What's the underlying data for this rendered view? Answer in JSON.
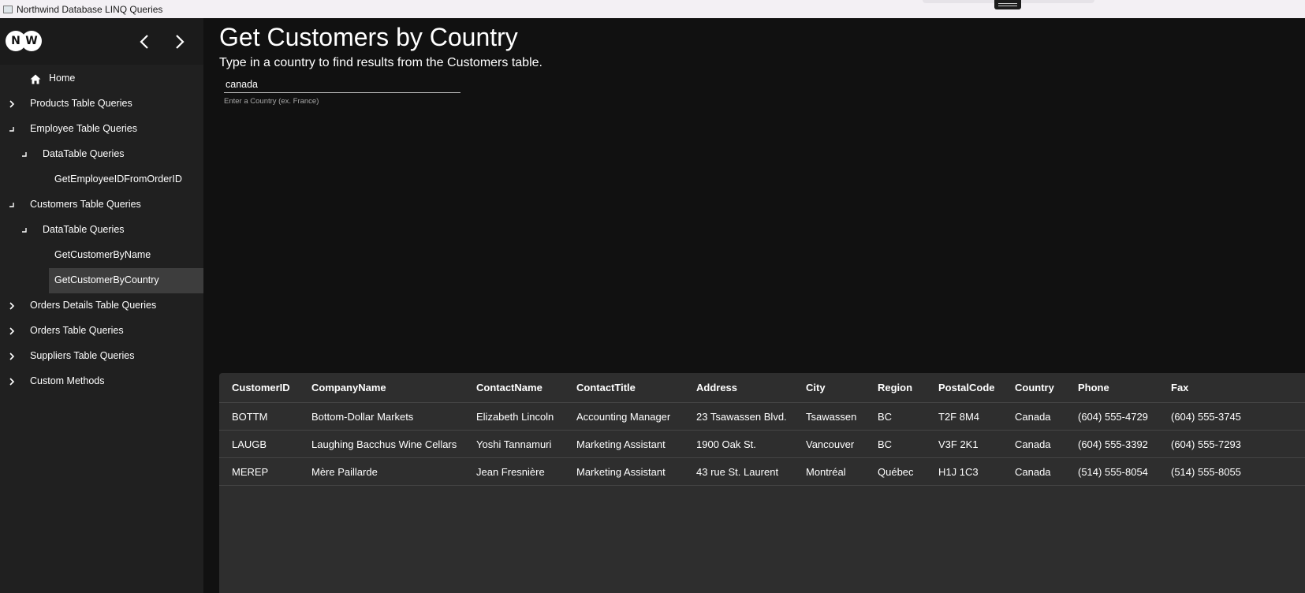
{
  "window": {
    "title": "Northwind Database LINQ Queries"
  },
  "logo": {
    "left": "N",
    "right": "W"
  },
  "nav": [
    {
      "label": "Home",
      "glyph": "home-icon",
      "level": 0,
      "selected": false
    },
    {
      "label": "Products Table Queries",
      "glyph": "chevron-right-icon",
      "level": 0,
      "selected": false
    },
    {
      "label": "Employee Table Queries",
      "glyph": "expanded-icon",
      "level": 0,
      "selected": false
    },
    {
      "label": "DataTable Queries",
      "glyph": "expanded-icon",
      "level": 1,
      "selected": false
    },
    {
      "label": "GetEmployeeIDFromOrderID",
      "glyph": "",
      "level": 2,
      "selected": false
    },
    {
      "label": "Customers Table Queries",
      "glyph": "expanded-icon",
      "level": 0,
      "selected": false
    },
    {
      "label": "DataTable Queries",
      "glyph": "expanded-icon",
      "level": 1,
      "selected": false
    },
    {
      "label": "GetCustomerByName",
      "glyph": "",
      "level": 2,
      "selected": false
    },
    {
      "label": "GetCustomerByCountry",
      "glyph": "",
      "level": 2,
      "selected": true
    },
    {
      "label": "Orders Details Table Queries",
      "glyph": "chevron-right-icon",
      "level": 0,
      "selected": false
    },
    {
      "label": "Orders Table Queries",
      "glyph": "chevron-right-icon",
      "level": 0,
      "selected": false
    },
    {
      "label": "Suppliers Table Queries",
      "glyph": "chevron-right-icon",
      "level": 0,
      "selected": false
    },
    {
      "label": "Custom Methods",
      "glyph": "chevron-right-icon",
      "level": 0,
      "selected": false
    }
  ],
  "main": {
    "title": "Get Customers by Country",
    "subtitle": "Type in a country to find results from the Customers table.",
    "search": {
      "value": "canada",
      "help": "Enter a Country (ex. France)"
    }
  },
  "table": {
    "columns": [
      "CustomerID",
      "CompanyName",
      "ContactName",
      "ContactTitle",
      "Address",
      "City",
      "Region",
      "PostalCode",
      "Country",
      "Phone",
      "Fax"
    ],
    "rows": [
      [
        "BOTTM",
        "Bottom-Dollar Markets",
        "Elizabeth Lincoln",
        "Accounting Manager",
        "23 Tsawassen Blvd.",
        "Tsawassen",
        "BC",
        "T2F 8M4",
        "Canada",
        "(604) 555-4729",
        "(604) 555-3745"
      ],
      [
        "LAUGB",
        "Laughing Bacchus Wine Cellars",
        "Yoshi Tannamuri",
        "Marketing Assistant",
        "1900 Oak St.",
        "Vancouver",
        "BC",
        "V3F 2K1",
        "Canada",
        "(604) 555-3392",
        "(604) 555-7293"
      ],
      [
        "MEREP",
        "Mère Paillarde",
        "Jean Fresnière",
        "Marketing Assistant",
        "43 rue St. Laurent",
        "Montréal",
        "Québec",
        "H1J 1C3",
        "Canada",
        "(514) 555-8054",
        "(514) 555-8055"
      ]
    ]
  },
  "colors": {
    "background": "#111111",
    "sidebar": "#202020",
    "grid": "#2e2e2e",
    "selection": "#3d3d3d"
  }
}
